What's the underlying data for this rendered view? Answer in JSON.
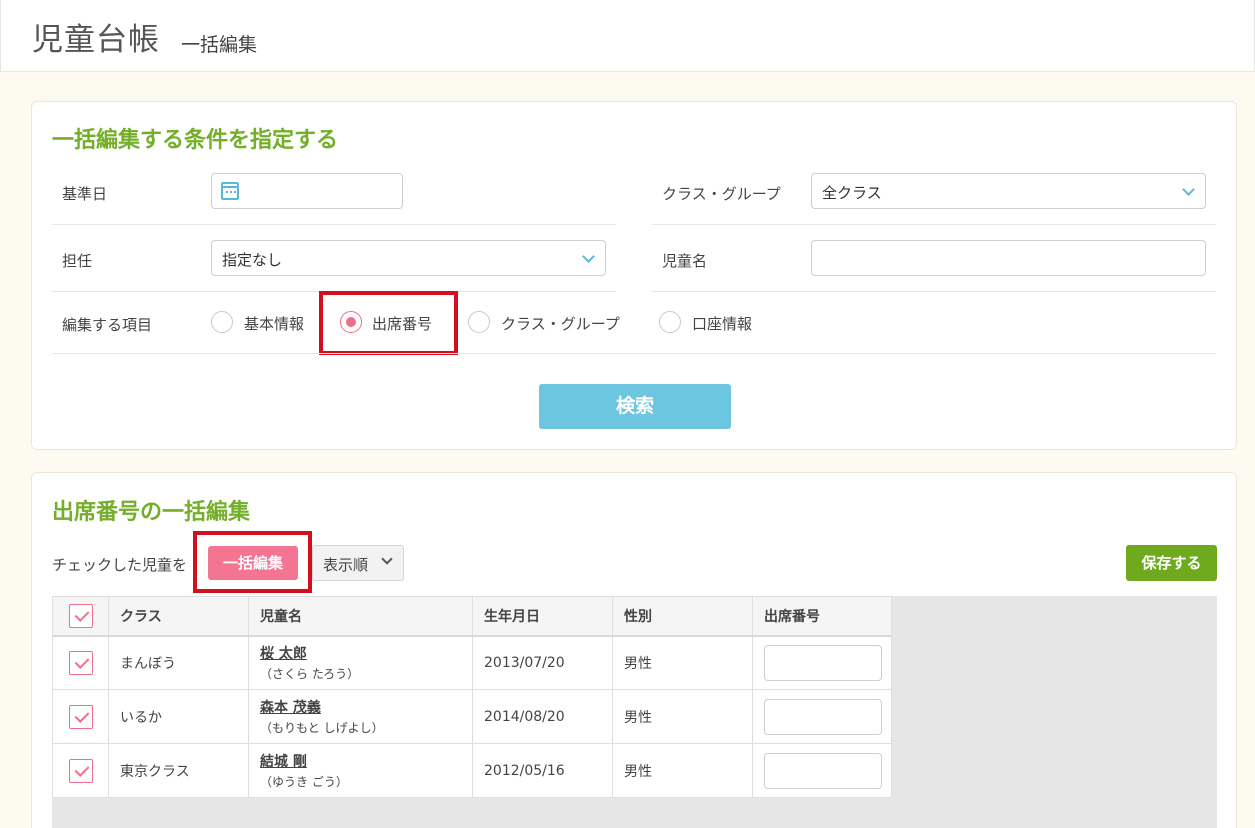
{
  "header": {
    "title": "児童台帳",
    "subtitle": "一括編集"
  },
  "conditions": {
    "title": "一括編集する条件を指定する",
    "base_date_label": "基準日",
    "base_date_value": "",
    "class_group_label": "クラス・グループ",
    "class_group_value": "全クラス",
    "teacher_label": "担任",
    "teacher_value": "指定なし",
    "child_name_label": "児童名",
    "child_name_value": "",
    "edit_item_label": "編集する項目",
    "edit_item_options": [
      "基本情報",
      "出席番号",
      "クラス・グループ",
      "口座情報"
    ],
    "selected_option": "出席番号",
    "search_button": "検索"
  },
  "bulk": {
    "title": "出席番号の一括編集",
    "checked_prefix": "チェックした児童を",
    "bulk_button": "一括編集",
    "order_button": "表示順",
    "save_button": "保存する",
    "columns": [
      "クラス",
      "児童名",
      "生年月日",
      "性別",
      "出席番号"
    ],
    "rows": [
      {
        "checked": true,
        "class": "まんぼう",
        "name": "桜 太郎",
        "kana": "（さくら たろう）",
        "birthday": "2013/07/20",
        "gender": "男性",
        "number": ""
      },
      {
        "checked": true,
        "class": "いるか",
        "name": "森本 茂義",
        "kana": "（もりもと しげよし）",
        "birthday": "2014/08/20",
        "gender": "男性",
        "number": ""
      },
      {
        "checked": true,
        "class": "東京クラス",
        "name": "結城 剛",
        "kana": "（ゆうき ごう）",
        "birthday": "2012/05/16",
        "gender": "男性",
        "number": ""
      }
    ]
  },
  "colors": {
    "accent_green": "#74ae2a",
    "accent_blue": "#6cc6df",
    "accent_pink": "#f37591",
    "highlight_red": "#d10f1f"
  }
}
